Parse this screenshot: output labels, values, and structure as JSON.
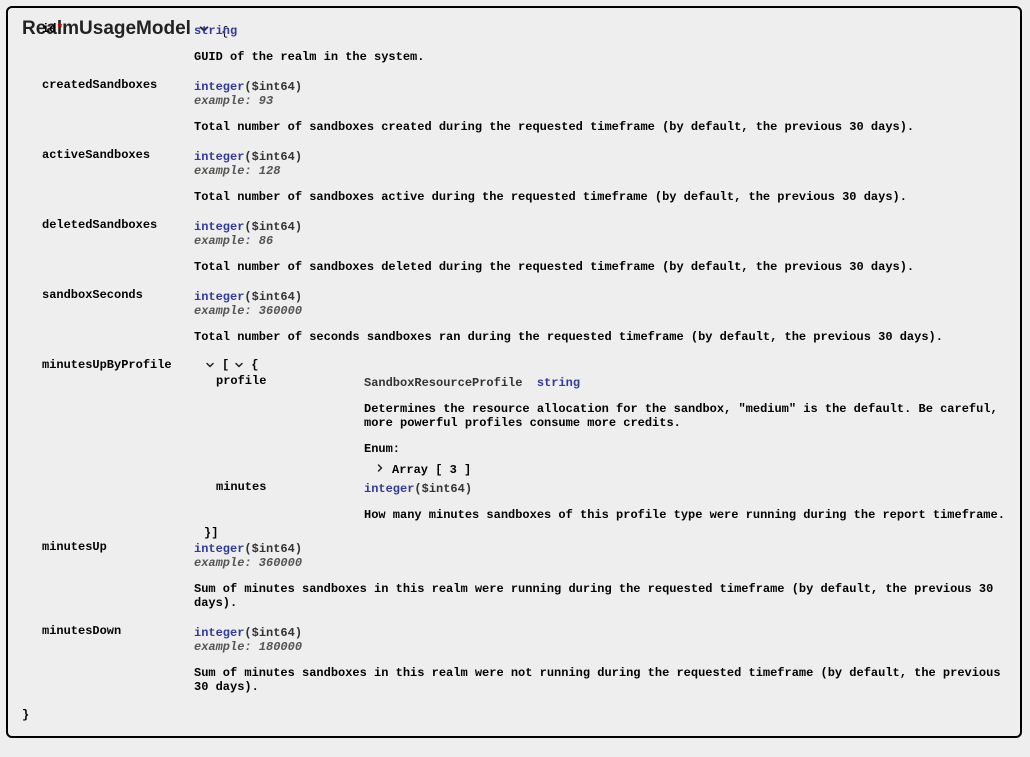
{
  "model": {
    "name": "RealmUsageModel",
    "open_brace": "{",
    "close_brace": "}"
  },
  "props": {
    "id": {
      "name": "id",
      "required": "*",
      "type": "string",
      "desc": "GUID of the realm in the system."
    },
    "createdSandboxes": {
      "name": "createdSandboxes",
      "type": "integer",
      "format": "($int64)",
      "example": "example: 93",
      "desc": "Total number of sandboxes created during the requested timeframe (by default, the previous 30 days)."
    },
    "activeSandboxes": {
      "name": "activeSandboxes",
      "type": "integer",
      "format": "($int64)",
      "example": "example: 128",
      "desc": "Total number of sandboxes active during the requested timeframe (by default, the previous 30 days)."
    },
    "deletedSandboxes": {
      "name": "deletedSandboxes",
      "type": "integer",
      "format": "($int64)",
      "example": "example: 86",
      "desc": "Total number of sandboxes deleted during the requested timeframe (by default, the previous 30 days)."
    },
    "sandboxSeconds": {
      "name": "sandboxSeconds",
      "type": "integer",
      "format": "($int64)",
      "example": "example: 360000",
      "desc": "Total number of seconds sandboxes ran during the requested timeframe (by default, the previous 30 days)."
    },
    "minutesUpByProfile": {
      "name": "minutesUpByProfile",
      "head_open": "[",
      "head_brace": "{",
      "profile": {
        "name": "profile",
        "title": "SandboxResourceProfile",
        "type": "string",
        "desc": "Determines the resource allocation for the sandbox, \"medium\" is the default. Be careful, more powerful profiles consume more credits.",
        "enum_label": "Enum:",
        "enum_arr": "Array [ 3 ]"
      },
      "minutes": {
        "name": "minutes",
        "type": "integer",
        "format": "($int64)",
        "desc": "How many minutes sandboxes of this profile type were running during the report timeframe."
      },
      "close": "}]"
    },
    "minutesUp": {
      "name": "minutesUp",
      "type": "integer",
      "format": "($int64)",
      "example": "example: 360000",
      "desc": "Sum of minutes sandboxes in this realm were running during the requested timeframe (by default, the previous 30 days)."
    },
    "minutesDown": {
      "name": "minutesDown",
      "type": "integer",
      "format": "($int64)",
      "example": "example: 180000",
      "desc": "Sum of minutes sandboxes in this realm were not running during the requested timeframe (by default, the previous 30 days)."
    }
  }
}
